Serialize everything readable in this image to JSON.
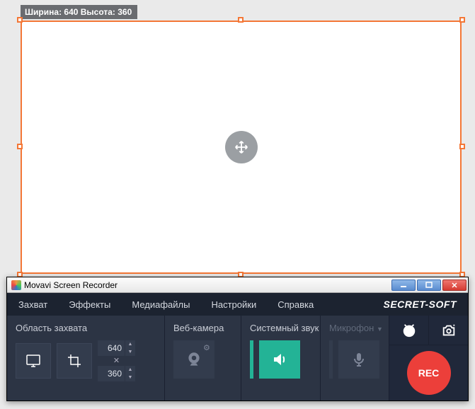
{
  "capture": {
    "dim_label": "Ширина: 640  Высота: 360",
    "width": "640",
    "height": "360"
  },
  "window": {
    "title": "Movavi Screen Recorder",
    "brand": "SECRET-SOFT"
  },
  "menu": {
    "capture": "Захват",
    "effects": "Эффекты",
    "media": "Медиафайлы",
    "settings": "Настройки",
    "help": "Справка"
  },
  "panels": {
    "area_label": "Область захвата",
    "webcam_label": "Веб-камера",
    "sysaudio_label": "Системный звук",
    "mic_label": "Микрофон"
  },
  "rec": {
    "label": "REC"
  },
  "colors": {
    "accent": "#f47736",
    "rec": "#ec3f3a",
    "teal": "#23b396"
  }
}
